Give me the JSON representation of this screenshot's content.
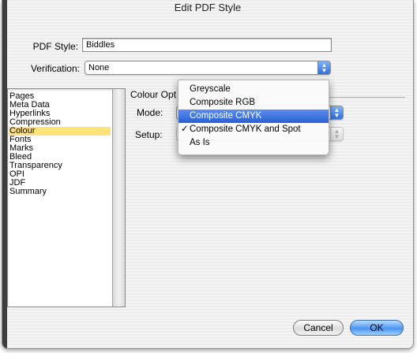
{
  "window": {
    "title": "Edit PDF Style"
  },
  "pdf_style": {
    "label": "PDF Style:",
    "value": "Biddles"
  },
  "verification": {
    "label": "Verification:",
    "value": "None"
  },
  "categories": [
    "Pages",
    "Meta Data",
    "Hyperlinks",
    "Compression",
    "Colour",
    "Fonts",
    "Marks",
    "Bleed",
    "Transparency",
    "OPI",
    "JDF",
    "Summary"
  ],
  "selected_category": "Colour",
  "colour_options": {
    "heading": "Colour Opt",
    "mode_label": "Mode:",
    "setup_label": "Setup:"
  },
  "mode_menu": {
    "items": [
      {
        "label": "Greyscale",
        "checked": false,
        "highlighted": false
      },
      {
        "label": "Composite RGB",
        "checked": false,
        "highlighted": false
      },
      {
        "label": "Composite CMYK",
        "checked": false,
        "highlighted": true
      },
      {
        "label": "Composite CMYK and Spot",
        "checked": true,
        "highlighted": false
      },
      {
        "label": "As Is",
        "checked": false,
        "highlighted": false
      }
    ],
    "check_glyph": "✓"
  },
  "buttons": {
    "cancel": "Cancel",
    "ok": "OK"
  },
  "colors": {
    "selection_highlight": "#ffe27a",
    "menu_highlight": "#2f66d6",
    "default_button": "#4a94f2"
  },
  "icons": {
    "popup_arrows": "updown-arrows-icon"
  }
}
